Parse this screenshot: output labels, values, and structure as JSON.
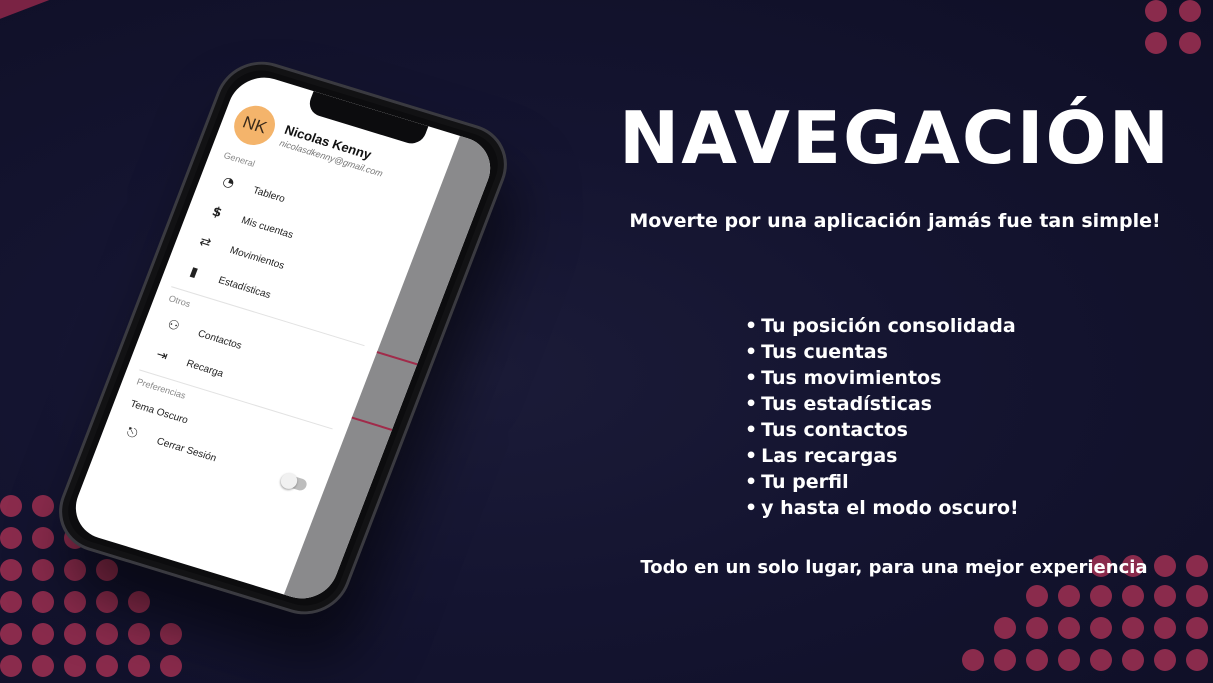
{
  "colors": {
    "background": "#141430",
    "accent": "#8a2b4c",
    "avatar": "#f4b46b"
  },
  "heading": {
    "title": "NAVEGACIÓN",
    "subtitle": "Moverte por una aplicación jamás fue tan simple!"
  },
  "features": [
    "Tu posición consolidada",
    "Tus cuentas",
    "Tus movimientos",
    "Tus estadísticas",
    "Tus contactos",
    "Las recargas",
    "Tu perfil",
    "y hasta el modo oscuro!"
  ],
  "footer": "Todo en un solo lugar, para una mejor experiencia",
  "app": {
    "profile": {
      "initials": "NK",
      "name": "Nicolas Kenny",
      "email": "nicolasdkenny@gmail.com"
    },
    "sections": {
      "general": "General",
      "otros": "Otros",
      "preferencias": "Preferencias"
    },
    "general_items": [
      {
        "label": "Tablero",
        "icon": "speedometer-icon"
      },
      {
        "label": "Mis cuentas",
        "icon": "dollar-icon"
      },
      {
        "label": "Movimientos",
        "icon": "transfer-icon"
      },
      {
        "label": "Estadísticas",
        "icon": "bar-chart-icon"
      }
    ],
    "otros_items": [
      {
        "label": "Contactos",
        "icon": "contacts-icon"
      },
      {
        "label": "Recarga",
        "icon": "recharge-icon"
      }
    ],
    "dark_mode_label": "Tema Oscuro",
    "dark_mode_on": false,
    "logout_label": "Cerrar Sesión"
  }
}
